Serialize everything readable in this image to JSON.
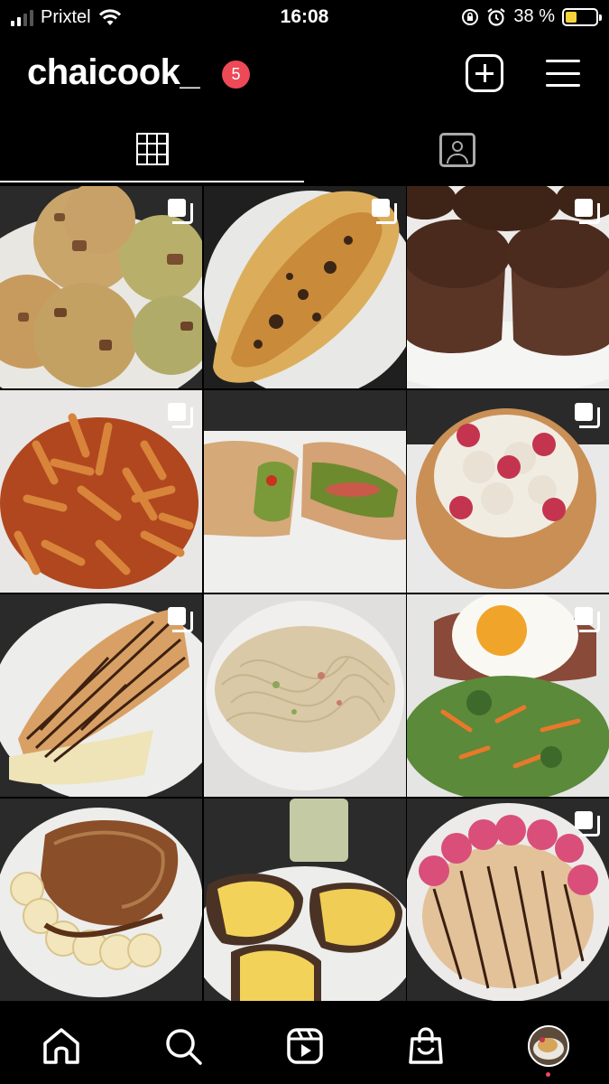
{
  "status_bar": {
    "carrier": "Prixtel",
    "time": "16:08",
    "battery_percent": "38 %",
    "battery_level": 0.38,
    "battery_color": "#f7d33b"
  },
  "profile": {
    "username": "chaicook_",
    "notification_count": "5"
  },
  "tabs": [
    {
      "icon": "grid-icon",
      "active": true
    },
    {
      "icon": "tagged-icon",
      "active": false
    }
  ],
  "posts": [
    {
      "subject": "cookies",
      "multiple": true
    },
    {
      "subject": "flatbread",
      "multiple": true
    },
    {
      "subject": "chocolate muffins",
      "multiple": true
    },
    {
      "subject": "pasta with tomato sauce",
      "multiple": true
    },
    {
      "subject": "wraps",
      "multiple": false
    },
    {
      "subject": "raspberry charlotte",
      "multiple": true
    },
    {
      "subject": "crepes with chocolate",
      "multiple": true
    },
    {
      "subject": "spaghetti",
      "multiple": false
    },
    {
      "subject": "egg on toast with salad",
      "multiple": true
    },
    {
      "subject": "french toast with banana",
      "multiple": false
    },
    {
      "subject": "scrambled egg toasts",
      "multiple": false
    },
    {
      "subject": "pancakes with raspberries",
      "multiple": true
    }
  ],
  "bottom_nav": [
    {
      "icon": "home-icon"
    },
    {
      "icon": "search-icon"
    },
    {
      "icon": "reels-icon"
    },
    {
      "icon": "shop-icon"
    },
    {
      "icon": "profile-avatar"
    }
  ],
  "colors": {
    "background": "#000000",
    "badge": "#ed4956"
  }
}
